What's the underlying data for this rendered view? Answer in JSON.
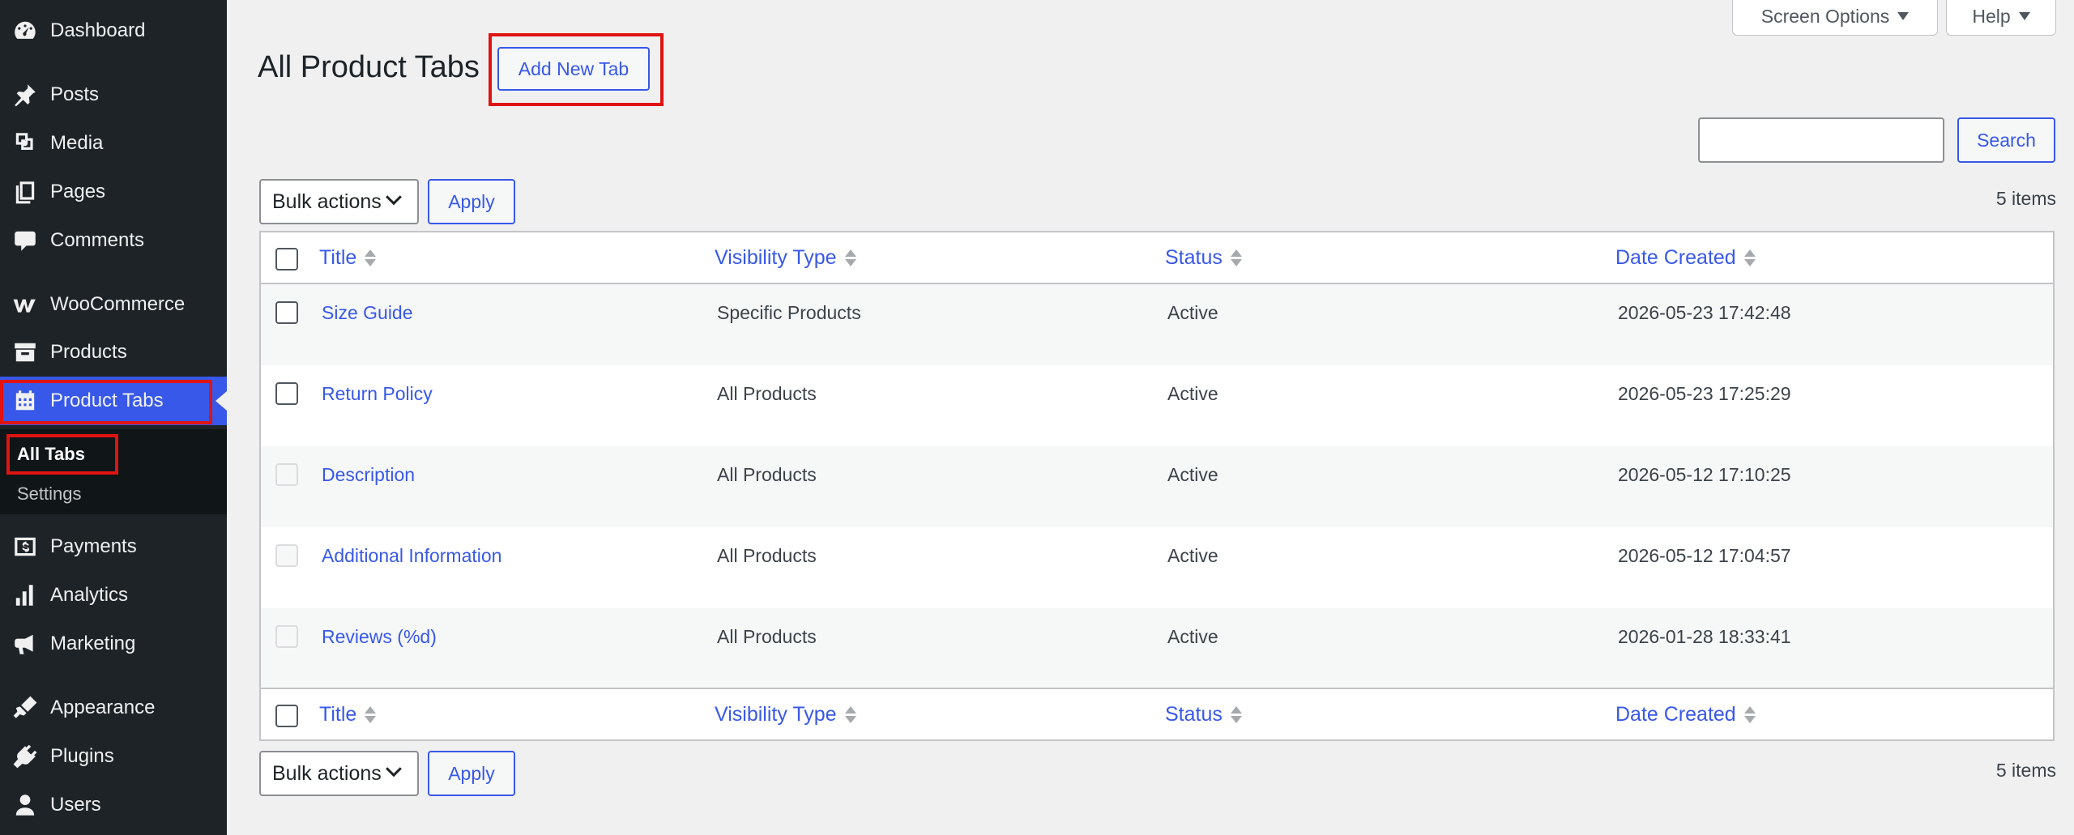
{
  "sidebar": {
    "items": [
      {
        "label": "Dashboard",
        "icon": "dashboard-icon"
      },
      {
        "label": "Posts",
        "icon": "pin-icon"
      },
      {
        "label": "Media",
        "icon": "media-icon"
      },
      {
        "label": "Pages",
        "icon": "pages-icon"
      },
      {
        "label": "Comments",
        "icon": "comment-icon"
      },
      {
        "label": "WooCommerce",
        "icon": "woocommerce-icon"
      },
      {
        "label": "Products",
        "icon": "archive-icon"
      },
      {
        "label": "Product Tabs",
        "icon": "calendar-icon",
        "active": true
      },
      {
        "label": "Payments",
        "icon": "payments-icon"
      },
      {
        "label": "Analytics",
        "icon": "bar-chart-icon"
      },
      {
        "label": "Marketing",
        "icon": "megaphone-icon"
      },
      {
        "label": "Appearance",
        "icon": "brush-icon"
      },
      {
        "label": "Plugins",
        "icon": "plugin-icon"
      },
      {
        "label": "Users",
        "icon": "user-icon"
      }
    ],
    "submenu": [
      {
        "label": "All Tabs",
        "current": true
      },
      {
        "label": "Settings"
      }
    ]
  },
  "top": {
    "screen_options": "Screen Options",
    "help": "Help"
  },
  "page": {
    "title": "All Product Tabs",
    "add_new": "Add New Tab",
    "search_button": "Search",
    "bulk_actions": "Bulk actions",
    "apply": "Apply",
    "items_count": "5 items"
  },
  "table": {
    "columns": [
      "Title",
      "Visibility Type",
      "Status",
      "Date Created"
    ],
    "rows": [
      {
        "title": "Size Guide",
        "visibility": "Specific Products",
        "status": "Active",
        "date": "2026-05-23 17:42:48",
        "checkbox_enabled": true
      },
      {
        "title": "Return Policy",
        "visibility": "All Products",
        "status": "Active",
        "date": "2026-05-23 17:25:29",
        "checkbox_enabled": true
      },
      {
        "title": "Description",
        "visibility": "All Products",
        "status": "Active",
        "date": "2026-05-12 17:10:25",
        "checkbox_enabled": false
      },
      {
        "title": "Additional Information",
        "visibility": "All Products",
        "status": "Active",
        "date": "2026-05-12 17:04:57",
        "checkbox_enabled": false
      },
      {
        "title": "Reviews (%d)",
        "visibility": "All Products",
        "status": "Active",
        "date": "2026-01-28 18:33:41",
        "checkbox_enabled": false
      }
    ]
  },
  "colors": {
    "sidebar_bg": "#1d2327",
    "accent": "#3858e9",
    "highlight": "#e01313"
  }
}
